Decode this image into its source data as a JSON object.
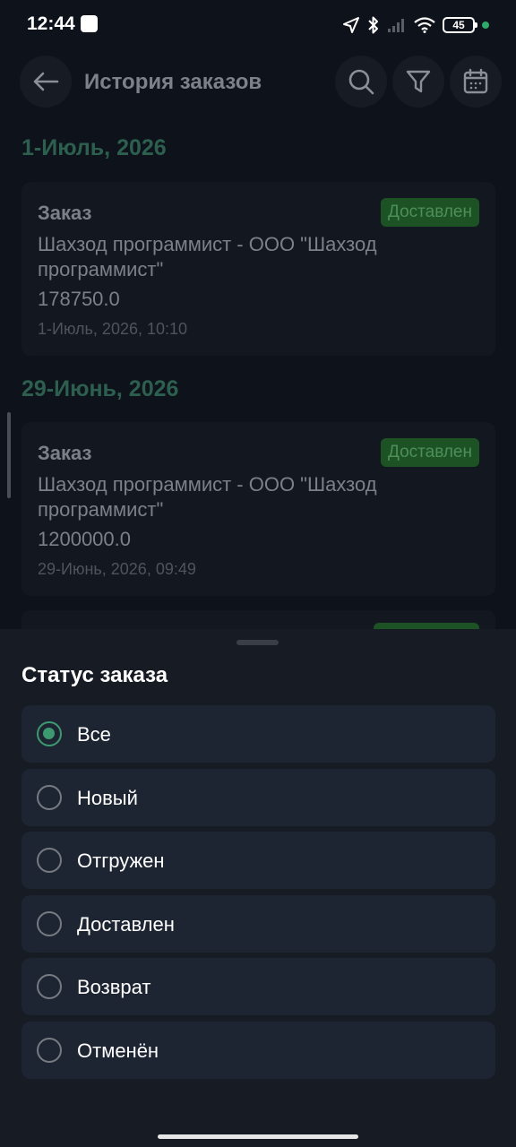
{
  "status_bar": {
    "time": "12:44",
    "battery": "45"
  },
  "header": {
    "title": "История заказов"
  },
  "groups": [
    {
      "date": "1-Июль, 2026",
      "orders": [
        {
          "label": "Заказ",
          "status": "Доставлен",
          "company": "Шахзод программист - ООО \"Шахзод программист\"",
          "amount": "178750.0",
          "datetime": "1-Июль, 2026, 10:10"
        }
      ]
    },
    {
      "date": "29-Июнь, 2026",
      "orders": [
        {
          "label": "Заказ",
          "status": "Доставлен",
          "company": "Шахзод программист - ООО \"Шахзод программист\"",
          "amount": "1200000.0",
          "datetime": "29-Июнь, 2026, 09:49"
        }
      ]
    }
  ],
  "sheet": {
    "title": "Статус заказа",
    "selected_index": 0,
    "options": [
      {
        "label": "Все"
      },
      {
        "label": "Новый"
      },
      {
        "label": "Отгружен"
      },
      {
        "label": "Доставлен"
      },
      {
        "label": "Возврат"
      },
      {
        "label": "Отменён"
      }
    ]
  },
  "colors": {
    "background": "#0e121a",
    "card": "#131820",
    "sheet": "#171c24",
    "option_row": "#1e2532",
    "accent_green": "#3d9a70",
    "date_header": "#2d5f4f",
    "status_badge_bg": "#1d5225",
    "status_badge_text": "#4c8f58"
  }
}
